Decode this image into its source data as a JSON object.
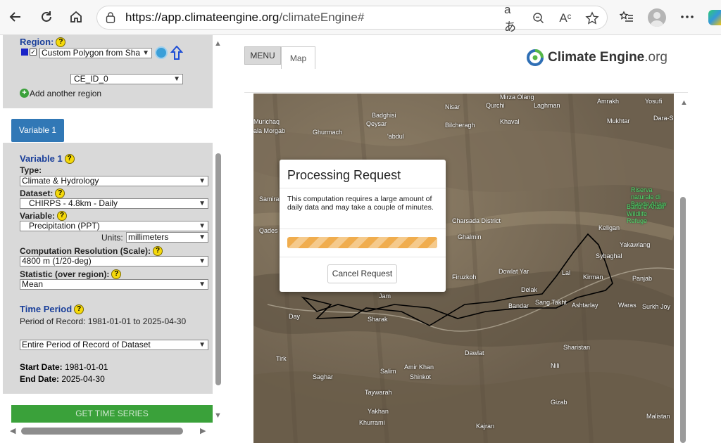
{
  "browser": {
    "url_host": "https://app.climateengine.org",
    "url_path": "/climateEngine#",
    "read_aloud_icon": "Aᶜ",
    "translate_icon": "aあ"
  },
  "region": {
    "title": "Region:",
    "polygon_select": "Custom Polygon from Sha",
    "id_select": "CE_ID_0",
    "add_region": "Add another region"
  },
  "variable_tab": "Variable 1",
  "variable": {
    "title": "Variable 1",
    "type_label": "Type:",
    "type_value": "Climate & Hydrology",
    "dataset_label": "Dataset:",
    "dataset_value": "CHIRPS - 4.8km - Daily",
    "variable_label": "Variable:",
    "variable_value": "Precipitation (PPT)",
    "units_label": "Units:",
    "units_value": "millimeters",
    "resolution_label": "Computation Resolution (Scale):",
    "resolution_value": "4800 m (1/20-deg)",
    "statistic_label": "Statistic (over region):",
    "statistic_value": "Mean"
  },
  "time_period": {
    "title": "Time Period",
    "record": "Period of Record: 1981-01-01 to 2025-04-30",
    "range_select": "Entire Period of Record of Dataset",
    "start_label": "Start Date:",
    "start_value": "1981-01-01",
    "end_label": "End Date:",
    "end_value": "2025-04-30"
  },
  "get_button": "GET TIME SERIES",
  "menu_button": "MENU",
  "map_tab": "Map",
  "brand": {
    "name": "Climate Engine",
    "suffix": ".org"
  },
  "modal": {
    "title": "Processing Request",
    "body": "This computation requires a large amount of daily data and may take a couple of minutes.",
    "cancel": "Cancel Request",
    "progress_color": "#f0ad4e"
  },
  "map_labels": [
    {
      "text": "Mirza Olang",
      "cls": ""
    },
    {
      "text": "Qurchi",
      "cls": ""
    },
    {
      "text": "Laghman",
      "cls": ""
    },
    {
      "text": "Amrakh",
      "cls": ""
    },
    {
      "text": "Yosufi",
      "cls": ""
    },
    {
      "text": "Nisar",
      "cls": ""
    },
    {
      "text": "Badghisi",
      "cls": ""
    },
    {
      "text": "Murichaq",
      "cls": ""
    },
    {
      "text": "Qeysar",
      "cls": ""
    },
    {
      "text": "Bilcheragh",
      "cls": ""
    },
    {
      "text": "Khaval",
      "cls": ""
    },
    {
      "text": "Mukhtar",
      "cls": ""
    },
    {
      "text": "Dara-S",
      "cls": ""
    },
    {
      "text": "ala Morgab",
      "cls": ""
    },
    {
      "text": "Ghurmach",
      "cls": ""
    },
    {
      "text": "'abdul",
      "cls": ""
    },
    {
      "text": "Riserva naturale di Bande Ahaw",
      "cls": "green"
    },
    {
      "text": "Band-e Ahaw Wildlife Refuge",
      "cls": "green"
    },
    {
      "text": "Samira",
      "cls": ""
    },
    {
      "text": "Qades",
      "cls": ""
    },
    {
      "text": "Charsada District",
      "cls": ""
    },
    {
      "text": "Ghalmin",
      "cls": ""
    },
    {
      "text": "Keligan",
      "cls": ""
    },
    {
      "text": "Yakawlang",
      "cls": ""
    },
    {
      "text": "Sybaghal",
      "cls": ""
    },
    {
      "text": "Firuzkoh",
      "cls": ""
    },
    {
      "text": "Dowlat Yar",
      "cls": ""
    },
    {
      "text": "Lal",
      "cls": ""
    },
    {
      "text": "Kirman",
      "cls": ""
    },
    {
      "text": "Panjab",
      "cls": ""
    },
    {
      "text": "Delak",
      "cls": ""
    },
    {
      "text": "Jam",
      "cls": ""
    },
    {
      "text": "Bandar",
      "cls": ""
    },
    {
      "text": "Sang Takht",
      "cls": ""
    },
    {
      "text": "Ashtarlay",
      "cls": ""
    },
    {
      "text": "Waras",
      "cls": ""
    },
    {
      "text": "Surkh Joy",
      "cls": ""
    },
    {
      "text": "Day",
      "cls": ""
    },
    {
      "text": "Sharak",
      "cls": ""
    },
    {
      "text": "Dawlat",
      "cls": ""
    },
    {
      "text": "Sharistan",
      "cls": ""
    },
    {
      "text": "Tirk",
      "cls": ""
    },
    {
      "text": "Amir Khan",
      "cls": ""
    },
    {
      "text": "Nili",
      "cls": ""
    },
    {
      "text": "Salim",
      "cls": ""
    },
    {
      "text": "Saghar",
      "cls": ""
    },
    {
      "text": "Shinkot",
      "cls": ""
    },
    {
      "text": "Taywarah",
      "cls": ""
    },
    {
      "text": "Gizab",
      "cls": ""
    },
    {
      "text": "Yakhan",
      "cls": ""
    },
    {
      "text": "Khurrami",
      "cls": ""
    },
    {
      "text": "Kajran",
      "cls": ""
    },
    {
      "text": "Malistan",
      "cls": ""
    }
  ]
}
